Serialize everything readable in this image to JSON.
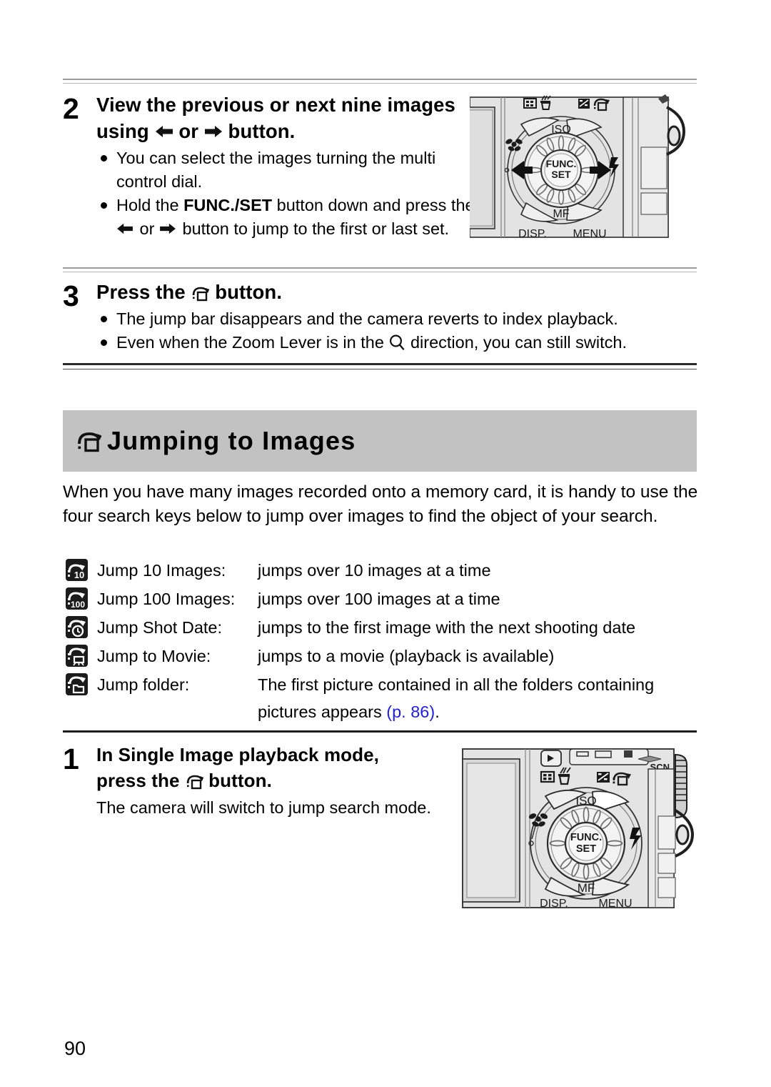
{
  "page": {
    "number": "90"
  },
  "steps": [
    {
      "number": "2",
      "heading_part1": "View the previous or next nine images using",
      "heading_mid": "or",
      "heading_part2": "button.",
      "bullets": [
        {
          "text": "You can select the images turning the multi control dial."
        },
        {
          "pre": "Hold the ",
          "bold": "FUNC./SET",
          "mid": " button down and press the ",
          "or": " or ",
          "post": " button to jump to the first or last set."
        }
      ]
    },
    {
      "number": "3",
      "heading_pre": "Press the",
      "heading_post": "button.",
      "bullets": [
        {
          "text": "The jump bar disappears and the camera reverts to index playback."
        },
        {
          "pre": "Even when the Zoom Lever is in the",
          "post": "direction, you can still switch."
        }
      ]
    },
    {
      "number": "1",
      "heading_line1": "In Single Image playback mode,",
      "heading_line2_pre": "press the",
      "heading_line2_post": "button.",
      "note": "The camera will switch to jump search mode."
    }
  ],
  "section": {
    "icon": "jump-icon",
    "title": "Jumping to Images",
    "intro": "When you have many images recorded onto a memory card, it is handy to use the four search keys below to jump over images to find the object of your search.",
    "jump_items": [
      {
        "icon": "jump-10-icon",
        "glyph": "10",
        "label": "Jump 10 Images:",
        "desc": "jumps over 10 images at a time",
        "desc_cont": ""
      },
      {
        "icon": "jump-100-icon",
        "glyph": "100",
        "label": "Jump 100 Images:",
        "desc": "jumps over 100 images at a time",
        "desc_cont": ""
      },
      {
        "icon": "jump-shot-date-icon",
        "glyph": "clock",
        "label": "Jump Shot Date:",
        "desc": "jumps to the first image with the next shooting date",
        "desc_cont": ""
      },
      {
        "icon": "jump-to-movie-icon",
        "glyph": "movie",
        "label": "Jump to Movie:",
        "desc": "jumps to a movie (playback is available)",
        "desc_cont": ""
      },
      {
        "icon": "jump-folder-icon",
        "glyph": "folder",
        "label": "Jump folder:",
        "desc": "The first picture contained in all the folders containing",
        "desc_cont_pre": "pictures appears ",
        "desc_cont_link": "(p. 86)",
        "desc_cont_post": "."
      }
    ]
  },
  "figures": {
    "top_camera": {
      "name": "camera-back-controls-diagram",
      "labels": {
        "iso": "ISO",
        "mf": "MF",
        "disp": "DISP.",
        "menu": "MENU",
        "func_set_line1": "FUNC.",
        "func_set_line2": "SET"
      }
    },
    "bottom_camera": {
      "name": "camera-back-full-diagram",
      "labels": {
        "iso": "ISO",
        "mf": "MF",
        "disp": "DISP.",
        "menu": "MENU",
        "func_set_line1": "FUNC.",
        "func_set_line2": "SET",
        "scn": "SCN"
      }
    }
  },
  "colors": {
    "banner_bg": "#c2c2c2",
    "link": "#1f1fe0",
    "icon_bg": "#1b1b1b",
    "rule_gray": "#9a9a9a",
    "rule_dark": "#2a2a2a"
  }
}
